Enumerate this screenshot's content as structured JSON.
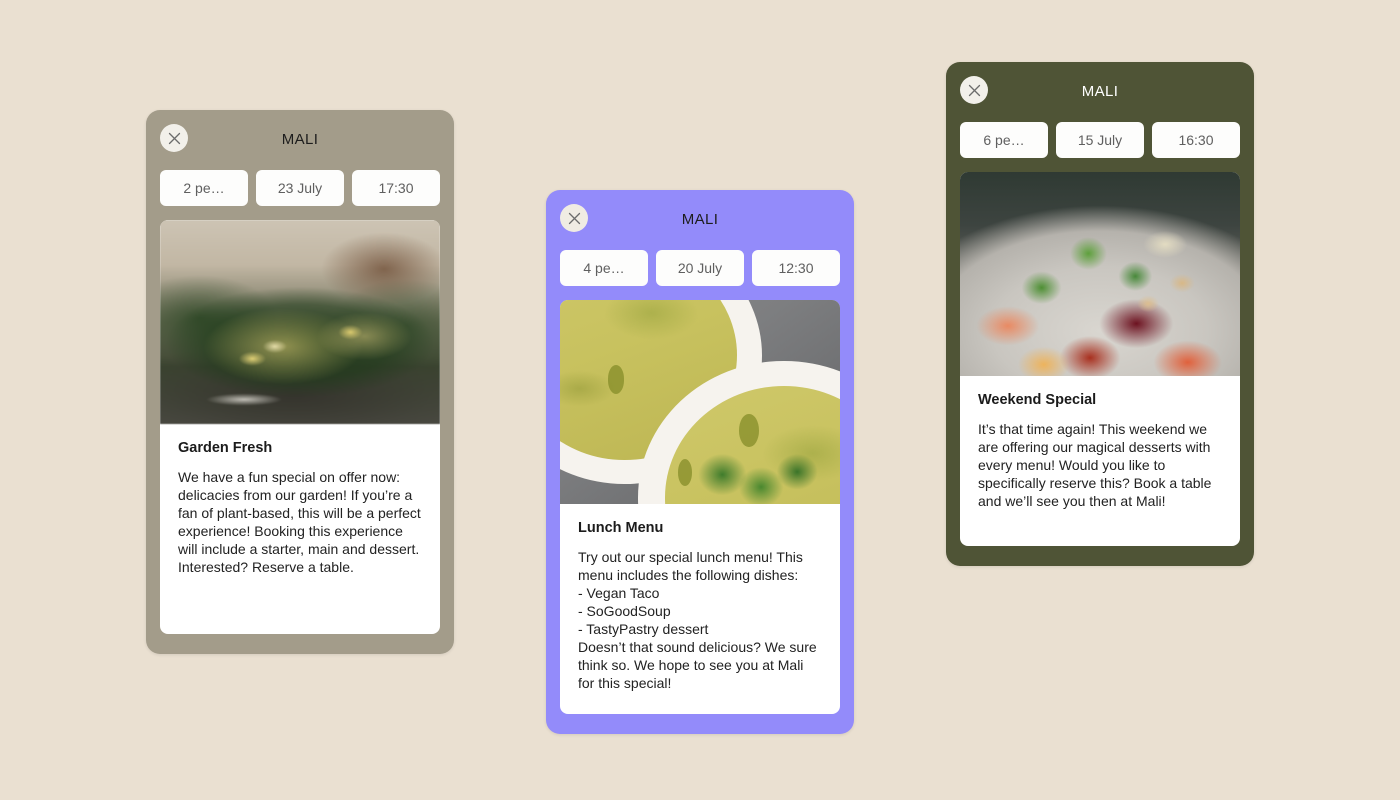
{
  "background_color": "#eae0d1",
  "cards": [
    {
      "id": "garden-fresh",
      "accent_color": "#a39c8a",
      "title": "MALI",
      "close_label": "Close",
      "pills": [
        {
          "name": "party-size",
          "value": "2 pe…"
        },
        {
          "name": "date",
          "value": "23 July"
        },
        {
          "name": "time",
          "value": "17:30"
        }
      ],
      "image_alt": "Charred broccolini salad with lemon slices in a dark pan",
      "heading": "Garden Fresh",
      "body": "We have a fun special on offer now: delicacies from our garden! If you’re a fan of plant-based, this will be a perfect experience! Booking this experience will include a starter, main and dessert. Interested? Reserve a table."
    },
    {
      "id": "lunch-menu",
      "accent_color": "#938bfa",
      "title": "MALI",
      "close_label": "Close",
      "pills": [
        {
          "name": "party-size",
          "value": "4 pe…"
        },
        {
          "name": "date",
          "value": "20 July"
        },
        {
          "name": "time",
          "value": "12:30"
        }
      ],
      "image_alt": "Two white bowls of yellow-green soup drizzled with oil and topped with cilantro",
      "heading": "Lunch Menu",
      "body": "Try out our special lunch menu! This menu includes the following dishes:\n- Vegan Taco\n- SoGoodSoup\n- TastyPastry dessert\nDoesn’t that sound delicious? We sure think so. We hope to see you at Mali for this special!"
    },
    {
      "id": "weekend-special",
      "accent_color": "#4f5436",
      "title": "MALI",
      "close_label": "Close",
      "pills": [
        {
          "name": "party-size",
          "value": "6 pe…"
        },
        {
          "name": "date",
          "value": "15 July"
        },
        {
          "name": "time",
          "value": "16:30"
        }
      ],
      "image_alt": "Beet and blood orange salad with almond flakes and herbs on a grey plate",
      "heading": "Weekend Special",
      "body": "It’s that time again! This weekend we are offering our magical desserts with every menu! Would you like to specifically reserve this? Book a table and we’ll see you then at Mali!"
    }
  ],
  "icons": {
    "close": "close-icon"
  }
}
